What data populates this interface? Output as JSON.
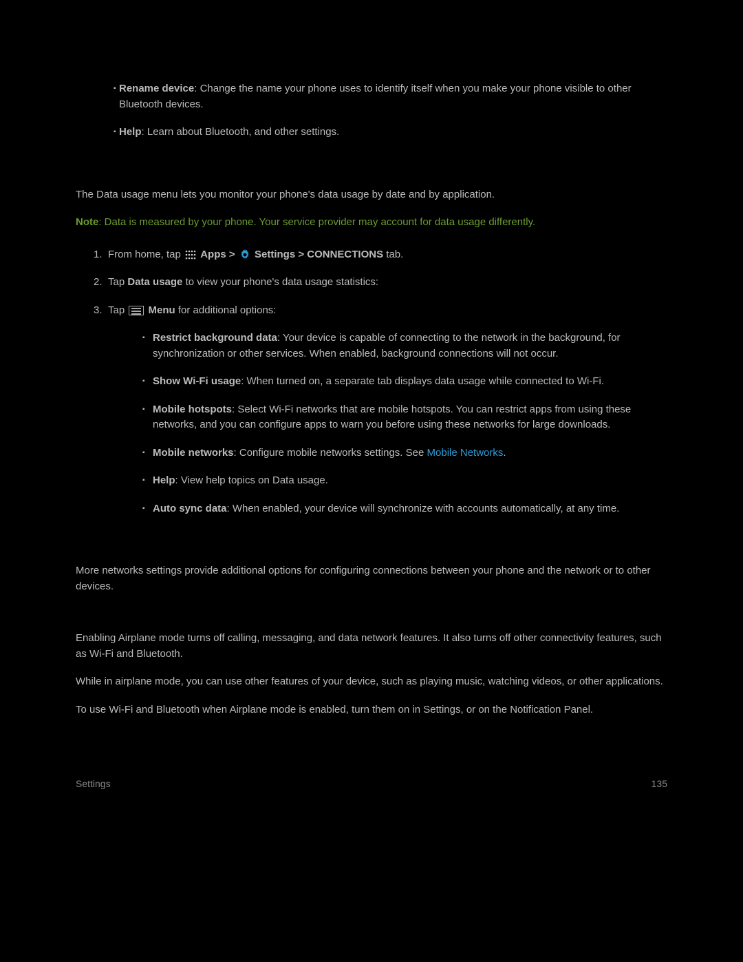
{
  "topBullets": [
    {
      "label": "Rename device",
      "text": ": Change the name your phone uses to identify itself when you make your phone visible to other Bluetooth devices."
    },
    {
      "label": "Help",
      "text": ": Learn about Bluetooth, and other settings."
    }
  ],
  "dataUsageIntro": "The Data usage menu lets you monitor your phone's data usage by date and by application.",
  "noteLabel": "Note",
  "noteText": ": Data is measured by your phone. Your service provider may account for data usage differently.",
  "steps": [
    {
      "n": "1.",
      "pre": "From home, tap ",
      "apps": "Apps > ",
      "settings": "Settings > CONNECTIONS",
      "tail": " tab."
    },
    {
      "n": "2.",
      "pre": "Tap ",
      "bold": "Data usage",
      "tail": " to view your phone's data usage statistics:"
    },
    {
      "n": "3.",
      "pre": "Tap ",
      "bold": "Menu",
      "tail": " for additional options:"
    }
  ],
  "menuOptions": [
    {
      "label": "Restrict background data",
      "text": ": Your device is capable of connecting to the network in the background, for synchronization or other services. When enabled, background connections will not occur."
    },
    {
      "label": "Show Wi-Fi usage",
      "text": ": When turned on, a separate tab displays data usage while connected to Wi-Fi."
    },
    {
      "label": "Mobile hotspots",
      "text": ": Select Wi-Fi networks that are mobile hotspots. You can restrict apps from using these networks, and you can configure apps to warn you before using these networks for large downloads."
    },
    {
      "label": "Mobile networks",
      "text": ": Configure mobile networks settings. See ",
      "link": "Mobile Networks",
      "after": "."
    },
    {
      "label": "Help",
      "text": ": View help topics on Data usage."
    },
    {
      "label": "Auto sync data",
      "text": ": When enabled, your device will synchronize with accounts automatically, at any time."
    }
  ],
  "moreNetworksIntro": "More networks settings provide additional options for configuring connections between your phone and the network or to other devices.",
  "airplane": [
    "Enabling Airplane mode turns off calling, messaging, and data network features. It also turns off other connectivity features, such as Wi-Fi and Bluetooth.",
    "While in airplane mode, you can use other features of your device, such as playing music, watching videos, or other applications.",
    "To use Wi-Fi and Bluetooth when Airplane mode is enabled, turn them on in Settings, or on the Notification Panel."
  ],
  "footerLeft": "Settings",
  "footerRight": "135"
}
